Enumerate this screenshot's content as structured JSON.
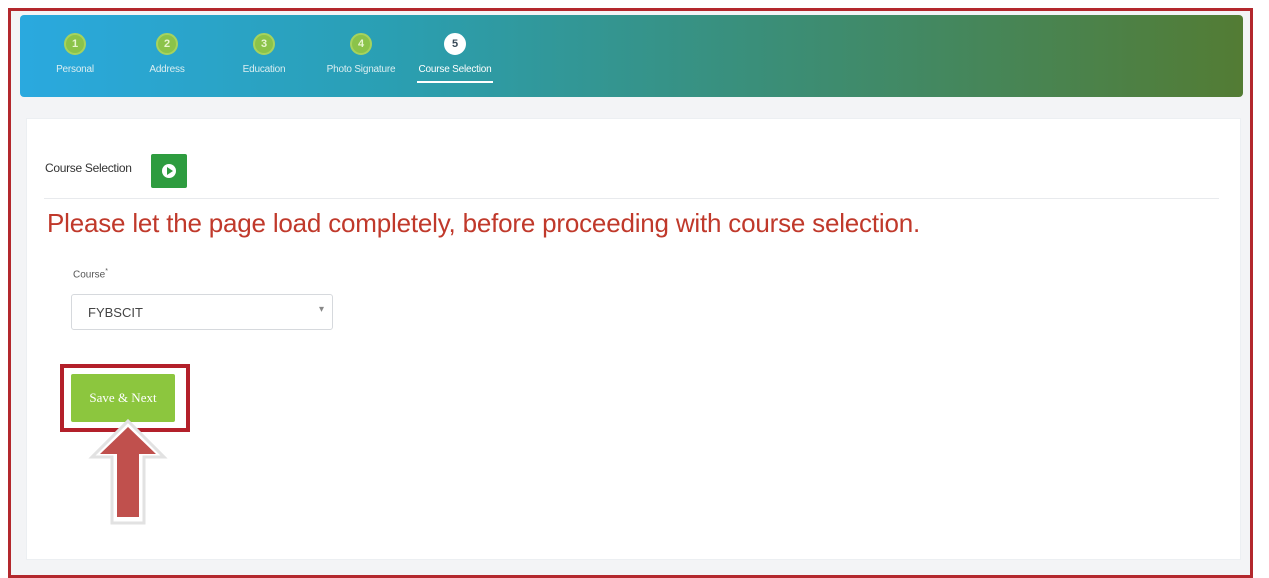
{
  "steps": [
    {
      "number": "1",
      "label": "Personal"
    },
    {
      "number": "2",
      "label": "Address"
    },
    {
      "number": "3",
      "label": "Education"
    },
    {
      "number": "4",
      "label": "Photo Signature"
    },
    {
      "number": "5",
      "label": "Course Selection",
      "active": true
    }
  ],
  "section": {
    "title": "Course Selection",
    "warning": "Please let the page load completely, before proceeding with course selection."
  },
  "course_field": {
    "label": "Course",
    "required_mark": "*",
    "value": "FYBSCIT"
  },
  "actions": {
    "save_next_label": "Save & Next"
  },
  "colors": {
    "warning_text": "#c0392b",
    "save_button": "#8cc63e",
    "highlight_border": "#b3202a",
    "play_button": "#2e9c3f"
  },
  "icons": {
    "play": "play-circle-icon",
    "select_caret": "chevron-down-icon",
    "pointer_arrow": "up-arrow-icon"
  }
}
